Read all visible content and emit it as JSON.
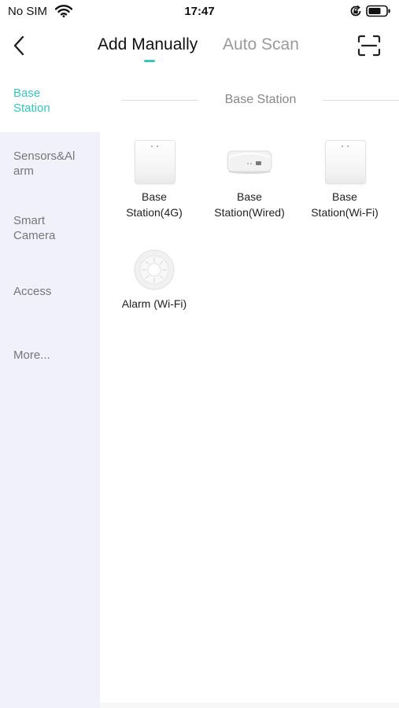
{
  "status_bar": {
    "carrier": "No SIM",
    "time": "17:47"
  },
  "nav": {
    "tabs": [
      {
        "label": "Add Manually",
        "active": true
      },
      {
        "label": "Auto Scan",
        "active": false
      }
    ],
    "accent_color": "#33c7c0"
  },
  "sidebar": {
    "items": [
      {
        "line1": "Base",
        "line2": "Station",
        "active": true
      },
      {
        "line1": "Sensors&Al",
        "line2": "arm",
        "active": false
      },
      {
        "line1": "Smart",
        "line2": "Camera",
        "active": false
      },
      {
        "line1": "Access",
        "line2": "",
        "active": false
      },
      {
        "line1": "More...",
        "line2": "",
        "active": false
      }
    ]
  },
  "content": {
    "section_title": "Base Station",
    "devices": [
      {
        "line1": "Base",
        "line2": "Station(4G)",
        "icon": "base-station-4g-icon"
      },
      {
        "line1": "Base",
        "line2": "Station(Wired)",
        "icon": "base-station-wired-icon"
      },
      {
        "line1": "Base",
        "line2": "Station(Wi-Fi)",
        "icon": "base-station-wifi-icon"
      },
      {
        "line1": "Alarm (Wi-Fi)",
        "line2": "",
        "icon": "alarm-wifi-icon"
      }
    ]
  }
}
